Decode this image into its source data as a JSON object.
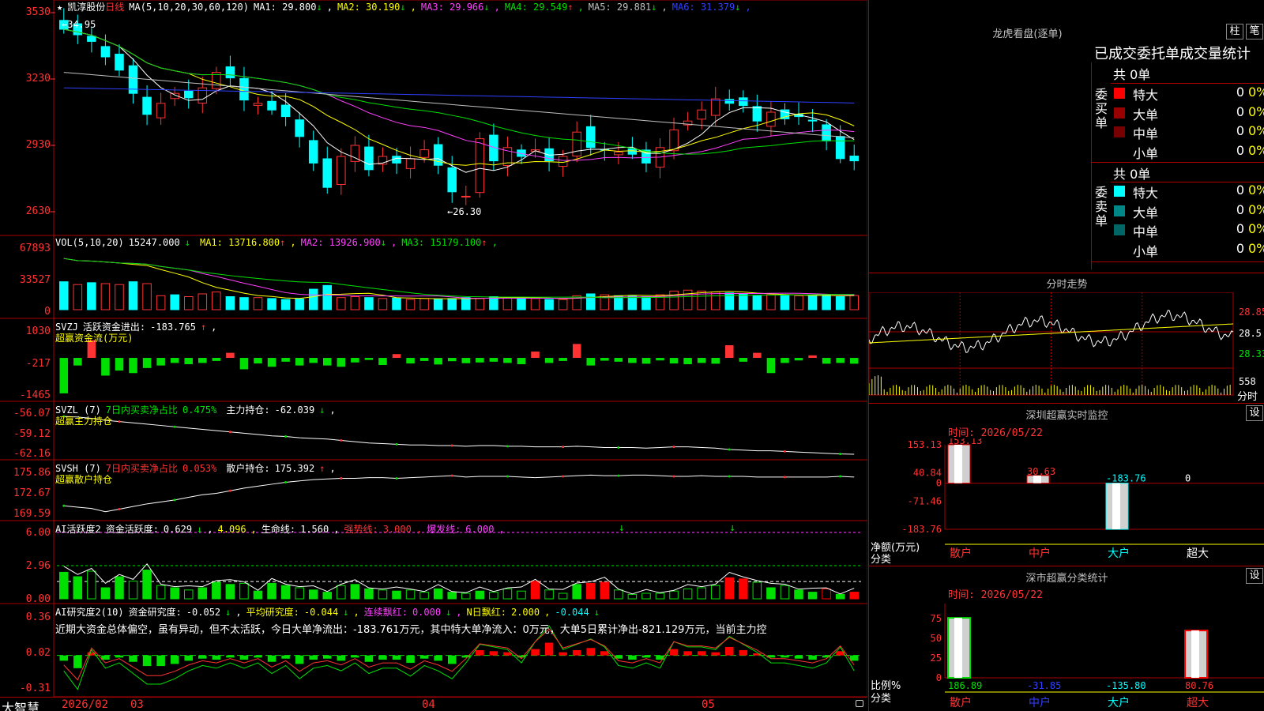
{
  "header": {
    "star": "★",
    "stock_name": "凯淳股份",
    "period": "日线",
    "ma_label": "MA(5,10,20,30,60,120)",
    "ma_values": [
      {
        "label": "MA1:",
        "value": "29.800",
        "arrow": "↓",
        "color": "#ffffff"
      },
      {
        "label": "MA2:",
        "value": "30.190",
        "arrow": "↓",
        "color": "#ffff00"
      },
      {
        "label": "MA3:",
        "value": "29.966",
        "arrow": "↓",
        "color": "#ff40ff"
      },
      {
        "label": "MA4:",
        "value": "29.549",
        "arrow": "↑",
        "color": "#00e000"
      },
      {
        "label": "MA5:",
        "value": "29.881",
        "arrow": "↓",
        "color": "#c0c0c0"
      },
      {
        "label": "MA6:",
        "value": "31.379",
        "arrow": "↓",
        "color": "#3040ff"
      }
    ]
  },
  "price_axis": [
    "3530",
    "3230",
    "2930",
    "2630"
  ],
  "price_annotations": {
    "high": "34.95",
    "low": "26.30"
  },
  "vol_panel": {
    "title": "VOL(5,10,20)",
    "value": "15247.000",
    "value_arrow": "↓",
    "ma": [
      {
        "label": "MA1:",
        "value": "13716.800",
        "arrow": "↑",
        "color": "#ffff00"
      },
      {
        "label": "MA2:",
        "value": "13926.900",
        "arrow": "↓",
        "color": "#ff40ff"
      },
      {
        "label": "MA3:",
        "value": "15179.100",
        "arrow": "↑",
        "color": "#00e000"
      }
    ],
    "axis": [
      "67893",
      "33527",
      "0"
    ]
  },
  "svzj_panel": {
    "title": "SVZJ",
    "label": "活跃资金进出:",
    "value": "-183.765",
    "arrow": "↑",
    "subtitle": "超赢资金流(万元)",
    "axis": [
      "1030",
      "-217",
      "-1465"
    ]
  },
  "svzl_panel": {
    "title": "SVZL (7)",
    "label1": "7日内买卖净占比",
    "value1": "0.475%",
    "label2": "主力持仓:",
    "value2": "-62.039",
    "arrow": "↓",
    "subtitle": "超赢主力持仓",
    "axis": [
      "-56.07",
      "-59.12",
      "-62.16"
    ]
  },
  "svsh_panel": {
    "title": "SVSH (7)",
    "label1": "7日内买卖净占比",
    "value1": "0.053%",
    "label2": "散户持仓:",
    "value2": "175.392",
    "arrow": "↑",
    "subtitle": "超赢散户持仓",
    "axis": [
      "175.86",
      "172.67",
      "169.59"
    ]
  },
  "ai_active_panel": {
    "title": "AI活跃度2",
    "label1": "资金活跃度:",
    "value1": "0.629",
    "value1_arrow": "↓",
    "value1b": "4.096",
    "label2": "生命线:",
    "value2": "1.560",
    "label3": "强势线:",
    "value3": "3.000",
    "label4": "爆发线:",
    "value4": "6.000",
    "axis": [
      "6.00",
      "2.96",
      "0.00"
    ]
  },
  "ai_research_panel": {
    "title": "AI研究度2(10)",
    "label1": "资金研究度:",
    "value1": "-0.052",
    "label2": "平均研究度:",
    "value2": "-0.044",
    "label3": "连续飘红:",
    "value3": "0.000",
    "label4": "N日飘红:",
    "value4": "2.000",
    "value4b": "-0.044",
    "comment": "近期大资金总体偏空，虽有异动，但不太活跃，今日大单净流出：-183.761万元，其中特大单净流入：0万元，大单5日累计净出-821.129万元，当前主力控",
    "axis": [
      "0.36",
      "0.02",
      "-0.31"
    ]
  },
  "bottom_bar": {
    "brand": "大智慧",
    "dates": [
      "2026/02",
      "03",
      "04",
      "05"
    ]
  },
  "right_panel": {
    "longhu": {
      "title": "龙虎看盘(逐单)",
      "btn1": "柱",
      "btn2": "笔",
      "subtitle": "已成交委托单成交量统计",
      "buy_header": "共 0单",
      "buy_side": "委买单",
      "sell_header": "共 0单",
      "sell_side": "委卖单",
      "buy_rows": [
        {
          "label": "特大",
          "count": "0",
          "pct": "0%",
          "color": "#ff0000"
        },
        {
          "label": "大单",
          "count": "0",
          "pct": "0%",
          "color": "#990000"
        },
        {
          "label": "中单",
          "count": "0",
          "pct": "0%",
          "color": "#770000"
        },
        {
          "label": "小单",
          "count": "0",
          "pct": "0%",
          "color": "#000000"
        }
      ],
      "sell_rows": [
        {
          "label": "特大",
          "count": "0",
          "pct": "0%",
          "color": "#00ffff"
        },
        {
          "label": "大单",
          "count": "0",
          "pct": "0%",
          "color": "#008888"
        },
        {
          "label": "中单",
          "count": "0",
          "pct": "0%",
          "color": "#006666"
        },
        {
          "label": "小单",
          "count": "0",
          "pct": "0%",
          "color": "#000000"
        }
      ]
    },
    "intraday": {
      "title": "分时走势",
      "price_labels": [
        "28.85",
        "28.5",
        "28.33"
      ],
      "volume_label": "558",
      "volume_unit": "分时"
    },
    "monitor": {
      "title": "深圳超赢实时监控",
      "btn": "设",
      "time_label": "时间: 2026/05/22",
      "axis": [
        "153.13",
        "40.84",
        "0",
        "-71.46",
        "-183.76"
      ],
      "y_title": "净额(万元)",
      "x_title": "分类",
      "bar_labels": [
        "153.13",
        "30.63",
        "-183.76",
        "0"
      ],
      "categories": [
        "散户",
        "中户",
        "大户",
        "超大"
      ]
    },
    "classify": {
      "title": "深市超赢分类统计",
      "btn": "设",
      "time_label": "时间: 2026/05/22",
      "axis": [
        "75",
        "50",
        "25",
        "0"
      ],
      "y_title": "比例%",
      "x_title": "分类",
      "values": [
        "186.89",
        "-31.85",
        "-135.80",
        "80.76"
      ],
      "categories": [
        "散户",
        "中户",
        "大户",
        "超大"
      ]
    }
  },
  "chart_data": [
    {
      "type": "candlestick",
      "ylim": [
        2630,
        3530
      ],
      "close": [
        3455,
        3430,
        3400,
        3330,
        3270,
        3165,
        3070,
        3120,
        3165,
        3145,
        3190,
        3260,
        3235,
        3135,
        3120,
        3090,
        3060,
        2970,
        2850,
        2740,
        2880,
        2930,
        2820,
        2880,
        2850,
        2870,
        2910,
        2840,
        2720,
        2700,
        2960,
        2860,
        2920,
        2880,
        2910,
        2860,
        2880,
        2990,
        2920,
        2910,
        2900,
        2890,
        2850,
        2920,
        3000,
        3040,
        3090,
        3140,
        3120,
        3110,
        3040,
        3080,
        3050,
        3060,
        3040,
        2950,
        2870,
        2860
      ]
    },
    {
      "type": "bar",
      "title": "VOL",
      "ylim": [
        0,
        67893
      ],
      "values": [
        30000,
        27000,
        29000,
        28000,
        27000,
        30000,
        28000,
        15000,
        16000,
        14000,
        17000,
        19000,
        14000,
        13000,
        13000,
        12000,
        11000,
        11500,
        22000,
        26000,
        13000,
        14000,
        13000,
        12000,
        12500,
        11000,
        12000,
        11500,
        12000,
        13000,
        12000,
        14000,
        13000,
        12500,
        12000,
        11000,
        11000,
        15000,
        17000,
        16000,
        15000,
        14500,
        14000,
        16000,
        20000,
        21000,
        20000,
        19000,
        18000,
        17000,
        15000,
        16000,
        15500,
        15000,
        15000,
        16000,
        14000,
        15247
      ],
      "up": [
        0,
        1,
        0,
        1,
        1,
        0,
        1,
        1,
        0,
        1,
        1,
        1,
        0,
        0,
        1,
        0,
        0,
        0,
        0,
        0,
        1,
        1,
        0,
        1,
        0,
        1,
        1,
        0,
        0,
        0,
        1,
        0,
        1,
        0,
        1,
        0,
        1,
        1,
        0,
        1,
        0,
        0,
        0,
        1,
        1,
        1,
        1,
        1,
        0,
        0,
        0,
        1,
        0,
        1,
        0,
        0,
        0,
        1
      ]
    },
    {
      "type": "bar",
      "title": "SVZJ",
      "ylim": [
        -1465,
        1030
      ],
      "values": [
        -1400,
        -300,
        700,
        -700,
        -500,
        -600,
        -400,
        -300,
        -200,
        -250,
        -200,
        -120,
        200,
        -450,
        -220,
        -350,
        -150,
        -300,
        -200,
        -300,
        -350,
        -180,
        -80,
        -280,
        150,
        -220,
        -120,
        -260,
        -130,
        -210,
        -180,
        -150,
        -200,
        -250,
        250,
        -200,
        -120,
        550,
        -300,
        -110,
        -150,
        -200,
        -230,
        -100,
        -220,
        -250,
        -200,
        -230,
        500,
        -150,
        200,
        -600,
        -200,
        -100,
        100,
        -230,
        -200,
        -230
      ]
    },
    {
      "type": "line",
      "title": "SVZL",
      "ylim": [
        -62.16,
        -56.07
      ],
      "values": [
        -56.2,
        -56.3,
        -56.5,
        -56.8,
        -57.0,
        -57.2,
        -57.4,
        -57.6,
        -57.8,
        -58.0,
        -58.2,
        -58.4,
        -58.6,
        -58.8,
        -59.0,
        -59.2,
        -59.3,
        -59.5,
        -59.6,
        -59.7,
        -59.9,
        -60.1,
        -60.3,
        -60.4,
        -60.5,
        -60.6,
        -60.6,
        -60.7,
        -60.7,
        -60.8,
        -60.7,
        -60.7,
        -60.8,
        -60.8,
        -60.9,
        -60.9,
        -60.9,
        -60.8,
        -60.9,
        -61.0,
        -61.0,
        -61.0,
        -61.1,
        -61.0,
        -60.9,
        -60.9,
        -61.0,
        -61.1,
        -61.3,
        -61.4,
        -61.5,
        -61.5,
        -61.6,
        -61.7,
        -61.8,
        -61.9,
        -62.0,
        -62.04
      ]
    },
    {
      "type": "line",
      "title": "SVSH",
      "ylim": [
        169.59,
        175.86
      ],
      "values": [
        171.0,
        170.8,
        170.6,
        170.1,
        170.5,
        170.9,
        171.3,
        171.6,
        171.9,
        172.3,
        172.7,
        172.9,
        173.3,
        173.7,
        174.0,
        174.3,
        174.6,
        174.8,
        175.0,
        175.1,
        175.2,
        175.2,
        175.3,
        175.3,
        175.2,
        175.3,
        175.4,
        175.5,
        175.6,
        175.4,
        175.5,
        175.5,
        175.5,
        175.4,
        175.3,
        175.4,
        175.5,
        175.6,
        175.7,
        175.6,
        175.6,
        175.7,
        175.7,
        175.6,
        175.5,
        175.5,
        175.6,
        175.5,
        175.5,
        175.5,
        175.4,
        175.4,
        175.4,
        175.4,
        175.4,
        175.4,
        175.5,
        175.39
      ]
    },
    {
      "type": "bar",
      "title": "AI活跃度2",
      "ylim": [
        0,
        6.0
      ],
      "values": [
        2.4,
        2.0,
        2.5,
        1.0,
        2.0,
        1.6,
        2.6,
        1.2,
        1.0,
        0.8,
        1.0,
        1.5,
        1.3,
        1.4,
        0.7,
        1.4,
        1.2,
        1.0,
        0.8,
        0.6,
        1.2,
        1.3,
        0.9,
        0.8,
        0.7,
        0.8,
        0.6,
        0.9,
        0.6,
        0.5,
        0.7,
        0.6,
        0.9,
        0.7,
        1.6,
        0.8,
        0.5,
        1.3,
        1.4,
        1.5,
        0.8,
        0.4,
        0.5,
        0.5,
        0.7,
        0.9,
        1.0,
        1.2,
        1.9,
        1.8,
        1.5,
        1.0,
        1.2,
        0.8,
        0.6,
        0.9,
        0.4,
        0.6
      ],
      "hollow": [
        0,
        0,
        1,
        0,
        0,
        1,
        0,
        1,
        0,
        1,
        0,
        0,
        0,
        1,
        0,
        0,
        0,
        1,
        0,
        0,
        1,
        0,
        0,
        1,
        0,
        1,
        1,
        0,
        0,
        1,
        0,
        1,
        1,
        1,
        0,
        1,
        1,
        0,
        0,
        0,
        1,
        1,
        1,
        1,
        1,
        1,
        1,
        1,
        0,
        0,
        1,
        0,
        1,
        0,
        0,
        1,
        0,
        0
      ],
      "red": [
        0,
        0,
        0,
        0,
        0,
        0,
        0,
        0,
        0,
        0,
        0,
        0,
        0,
        0,
        0,
        0,
        0,
        0,
        0,
        0,
        0,
        0,
        0,
        0,
        0,
        0,
        0,
        0,
        0,
        0,
        0,
        0,
        0,
        0,
        1,
        0,
        0,
        0,
        1,
        1,
        0,
        0,
        0,
        0,
        0,
        0,
        0,
        0,
        1,
        1,
        0,
        0,
        0,
        0,
        0,
        1,
        0,
        1
      ]
    },
    {
      "type": "bar",
      "title": "AI研究度2(10)",
      "ylim": [
        -0.31,
        0.36
      ],
      "values": [
        -0.05,
        -0.12,
        0.03,
        -0.04,
        -0.02,
        -0.06,
        -0.1,
        -0.1,
        -0.08,
        -0.05,
        -0.03,
        -0.04,
        -0.02,
        -0.04,
        -0.02,
        -0.06,
        -0.03,
        -0.08,
        -0.04,
        -0.03,
        -0.05,
        -0.02,
        -0.06,
        -0.04,
        -0.04,
        -0.07,
        -0.03,
        -0.05,
        -0.08,
        -0.02,
        0.05,
        0.04,
        0.03,
        -0.02,
        0.06,
        0.12,
        0.03,
        0.05,
        0.07,
        0.04,
        -0.03,
        -0.04,
        -0.02,
        -0.04,
        0.06,
        0.04,
        0.04,
        0.03,
        0.08,
        0.05,
        0.02,
        -0.02,
        -0.02,
        -0.03,
        -0.04,
        -0.02,
        0.04,
        -0.05
      ]
    }
  ]
}
